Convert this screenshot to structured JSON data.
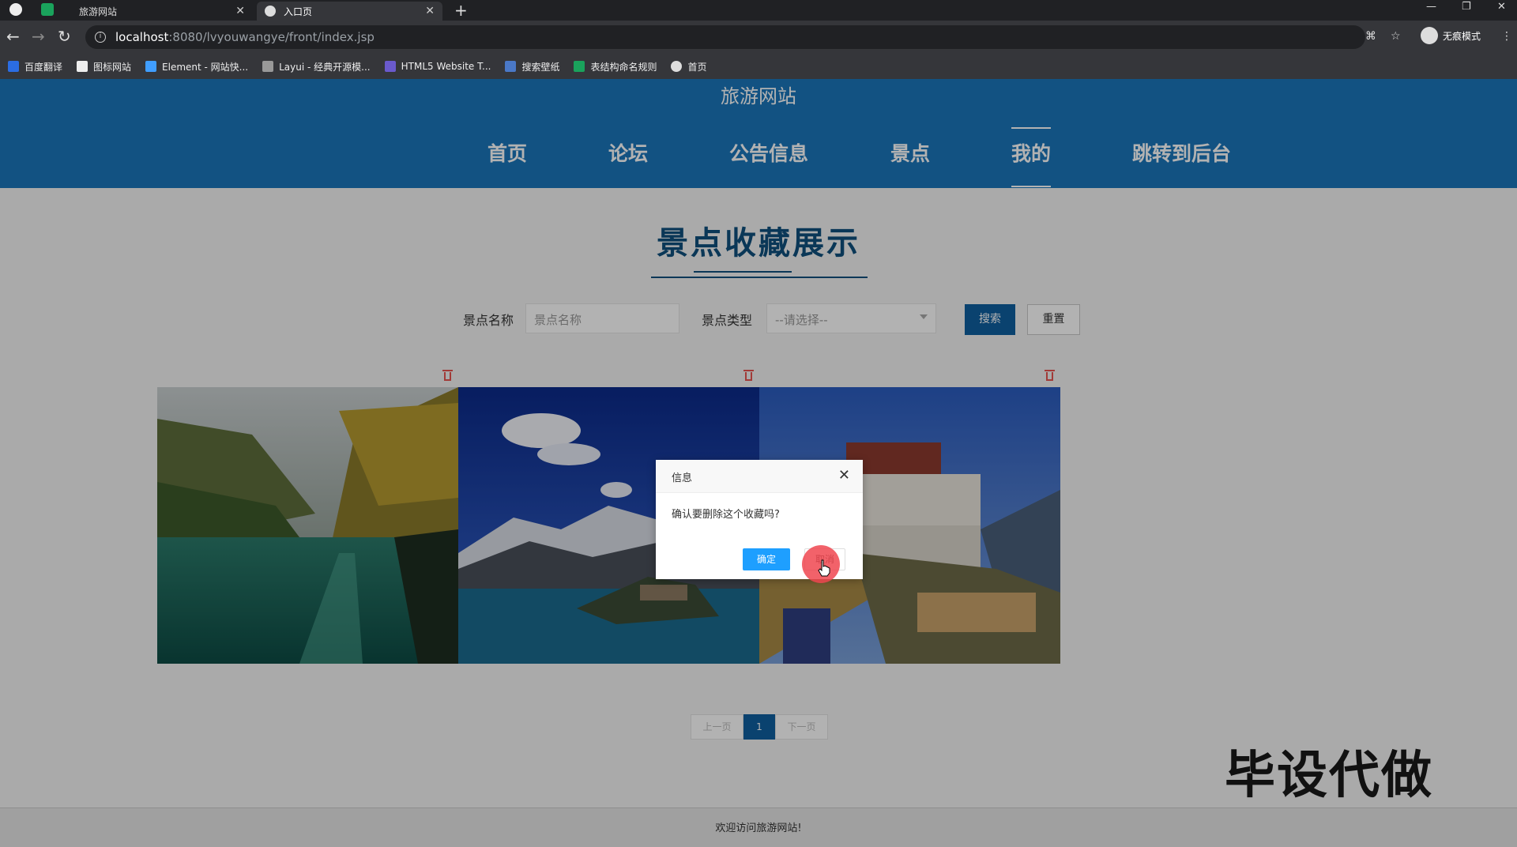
{
  "browser": {
    "tabs": [
      {
        "title": "旅游网站",
        "active": false
      },
      {
        "title": "入口页",
        "active": true
      }
    ],
    "url_host": "localhost",
    "url_path": ":8080/lvyouwangye/front/index.jsp",
    "profile_label": "无痕模式",
    "bookmarks": [
      {
        "label": "百度翻译",
        "color": "#2b6de3"
      },
      {
        "label": "图标网站",
        "color": "#eeeeee"
      },
      {
        "label": "Element - 网站快...",
        "color": "#409eff"
      },
      {
        "label": "Layui - 经典开源模...",
        "color": "#999999"
      },
      {
        "label": "HTML5 Website T...",
        "color": "#6a5acd"
      },
      {
        "label": "搜索壁纸",
        "color": "#4a78c7"
      },
      {
        "label": "表结构命名规则",
        "color": "#1aa35c"
      },
      {
        "label": "首页",
        "color": "#dddddd"
      }
    ]
  },
  "site": {
    "title": "旅游网站",
    "nav": [
      {
        "label": "首页",
        "active": false
      },
      {
        "label": "论坛",
        "active": false
      },
      {
        "label": "公告信息",
        "active": false
      },
      {
        "label": "景点",
        "active": false
      },
      {
        "label": "我的",
        "active": true
      },
      {
        "label": "跳转到后台",
        "active": false
      }
    ],
    "section_title": "景点收藏展示",
    "filter": {
      "name_label": "景点名称",
      "name_placeholder": "景点名称",
      "type_label": "景点类型",
      "type_selected": "--请选择--",
      "search_label": "搜索",
      "reset_label": "重置"
    },
    "pager": {
      "prev": "上一页",
      "current": "1",
      "next": "下一页"
    },
    "footer": "欢迎访问旅游网站!"
  },
  "dialog": {
    "title": "信息",
    "message": "确认要删除这个收藏吗?",
    "ok": "确定",
    "cancel": "取消"
  },
  "watermark": "毕设代做",
  "colors": {
    "brand": "#1a76bb",
    "primary_button": "#0f5fa0",
    "dialog_ok": "#1e9fff",
    "delete_icon": "#e8534f"
  }
}
